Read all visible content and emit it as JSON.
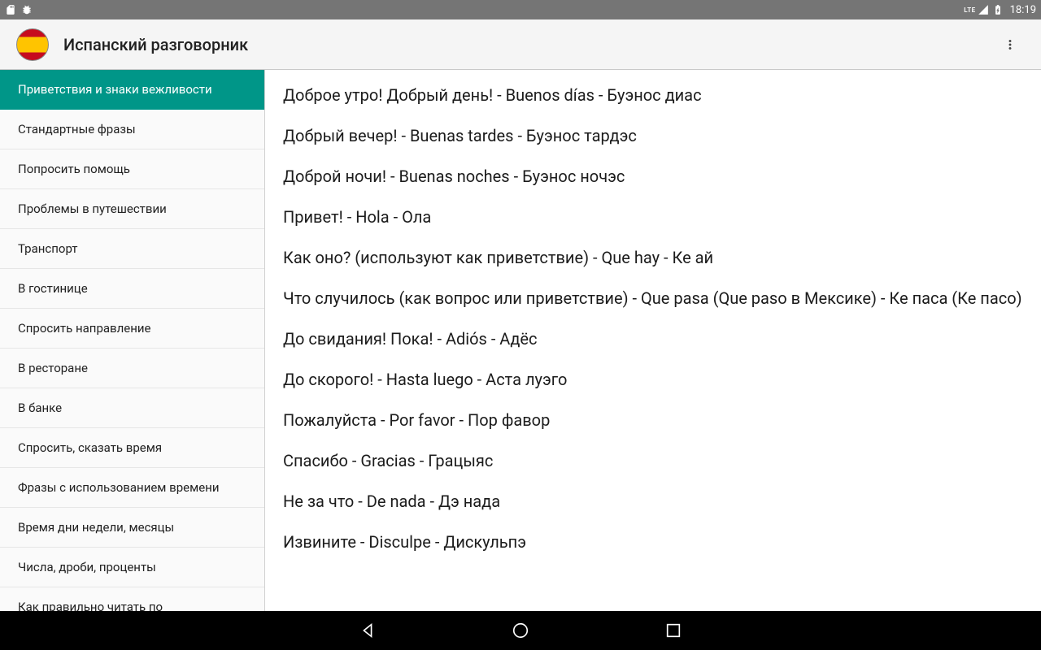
{
  "status": {
    "time": "18:19",
    "lte": "LTE"
  },
  "header": {
    "title": "Испанский разговорник"
  },
  "sidebar": {
    "selected_index": 0,
    "items": [
      {
        "label": "Приветствия и знаки вежливости"
      },
      {
        "label": "Стандартные фразы"
      },
      {
        "label": "Попросить помощь"
      },
      {
        "label": "Проблемы в путешествии"
      },
      {
        "label": "Транспорт"
      },
      {
        "label": "В гостинице"
      },
      {
        "label": "Спросить направление"
      },
      {
        "label": "В ресторане"
      },
      {
        "label": "В банке"
      },
      {
        "label": "Спросить, сказать время"
      },
      {
        "label": "Фразы с использованием времени"
      },
      {
        "label": "Время дни недели, месяцы"
      },
      {
        "label": "Числа, дроби, проценты"
      },
      {
        "label": "Как правильно читать по"
      }
    ]
  },
  "phrases": [
    {
      "text": "Доброе утро! Добрый день! - Buenos días - Буэнос диас"
    },
    {
      "text": "Добрый вечер! - Buenas tardes - Буэнос тардэс"
    },
    {
      "text": "Доброй ночи! - Buenas noches - Буэнос ночэс"
    },
    {
      "text": "Привет! - Hola - Ола"
    },
    {
      "text": "Как оно? (используют как приветствие) - Que hay - Ке ай"
    },
    {
      "text": "Что случилось (как вопрос или приветствие) - Que pasa (Que paso в Мексике) - Ке паса (Ке пасо)"
    },
    {
      "text": "До свидания! Пока! - Adiós - Адёс"
    },
    {
      "text": "До скорого! - Hasta luego - Аста луэго"
    },
    {
      "text": "Пожалуйста - Por favor - Пор фавор"
    },
    {
      "text": "Спасибо - Gracias - Грацыяс"
    },
    {
      "text": "Не за что - De nada - Дэ нада"
    },
    {
      "text": "Извините - Disculpe - Дискульпэ"
    }
  ]
}
